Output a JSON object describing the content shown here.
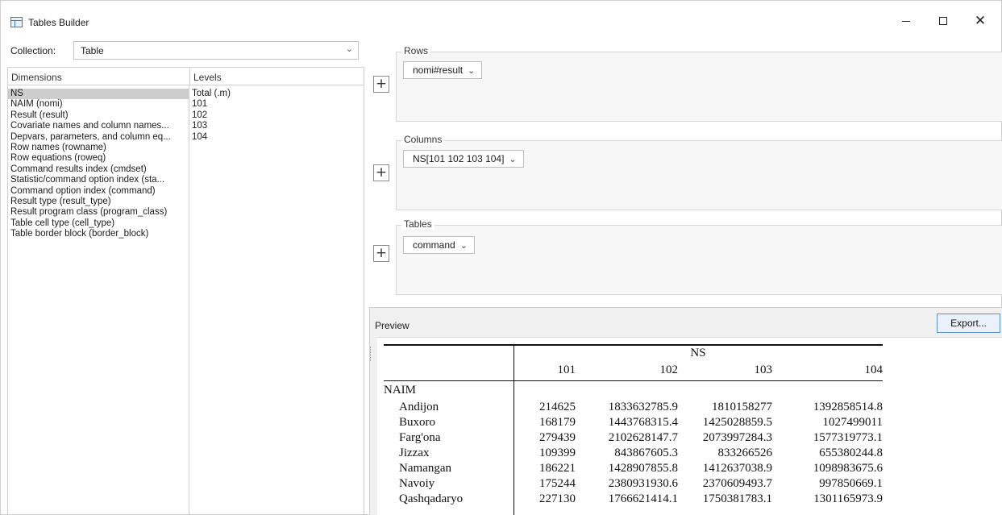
{
  "window": {
    "title": "Tables Builder",
    "controls": {
      "minimize": "–",
      "maximize": "□",
      "close": "✕"
    }
  },
  "collection": {
    "label": "Collection:",
    "value": "Table"
  },
  "dimensions": {
    "header": "Dimensions",
    "items": [
      "NS",
      "NAIM (nomi)",
      "Result (result)",
      "Covariate names and column names...",
      "Depvars, parameters, and column eq...",
      "Row names (rowname)",
      "Row equations (roweq)",
      "Command results index (cmdset)",
      "Statistic/command option index (sta...",
      "Command option index (command)",
      "Result type (result_type)",
      "Result program class (program_class)",
      "Table cell type (cell_type)",
      "Table border block (border_block)"
    ],
    "selected": "NS"
  },
  "levels": {
    "header": "Levels",
    "items": [
      "Total (.m)",
      "101",
      "102",
      "103",
      "104"
    ]
  },
  "layout": {
    "rows": {
      "label": "Rows",
      "chip": "nomi#result"
    },
    "columns": {
      "label": "Columns",
      "chip": "NS[101 102 103 104]"
    },
    "tables": {
      "label": "Tables",
      "chip": "command"
    },
    "add_symbol": "+"
  },
  "preview": {
    "label": "Preview",
    "export_label": "Export...",
    "table": {
      "super_header": "NS",
      "columns": [
        "101",
        "102",
        "103",
        "104"
      ],
      "group_label": "NAIM",
      "rows": [
        {
          "label": "Andijon",
          "values": [
            "214625",
            "1833632785.9",
            "1810158277",
            "1392858514.8"
          ]
        },
        {
          "label": "Buxoro",
          "values": [
            "168179",
            "1443768315.4",
            "1425028859.5",
            "1027499011"
          ]
        },
        {
          "label": "Farg'ona",
          "values": [
            "279439",
            "2102628147.7",
            "2073997284.3",
            "1577319773.1"
          ]
        },
        {
          "label": "Jizzax",
          "values": [
            "109399",
            "843867605.3",
            "833266526",
            "655380244.8"
          ]
        },
        {
          "label": "Namangan",
          "values": [
            "186221",
            "1428907855.8",
            "1412637038.9",
            "1098983675.6"
          ]
        },
        {
          "label": "Navoiy",
          "values": [
            "175244",
            "2380931930.6",
            "2370609493.7",
            "997850669.1"
          ]
        },
        {
          "label": "Qashqadaryo",
          "values": [
            "227130",
            "1766621414.1",
            "1750381783.1",
            "1301165973.9"
          ]
        }
      ]
    }
  }
}
